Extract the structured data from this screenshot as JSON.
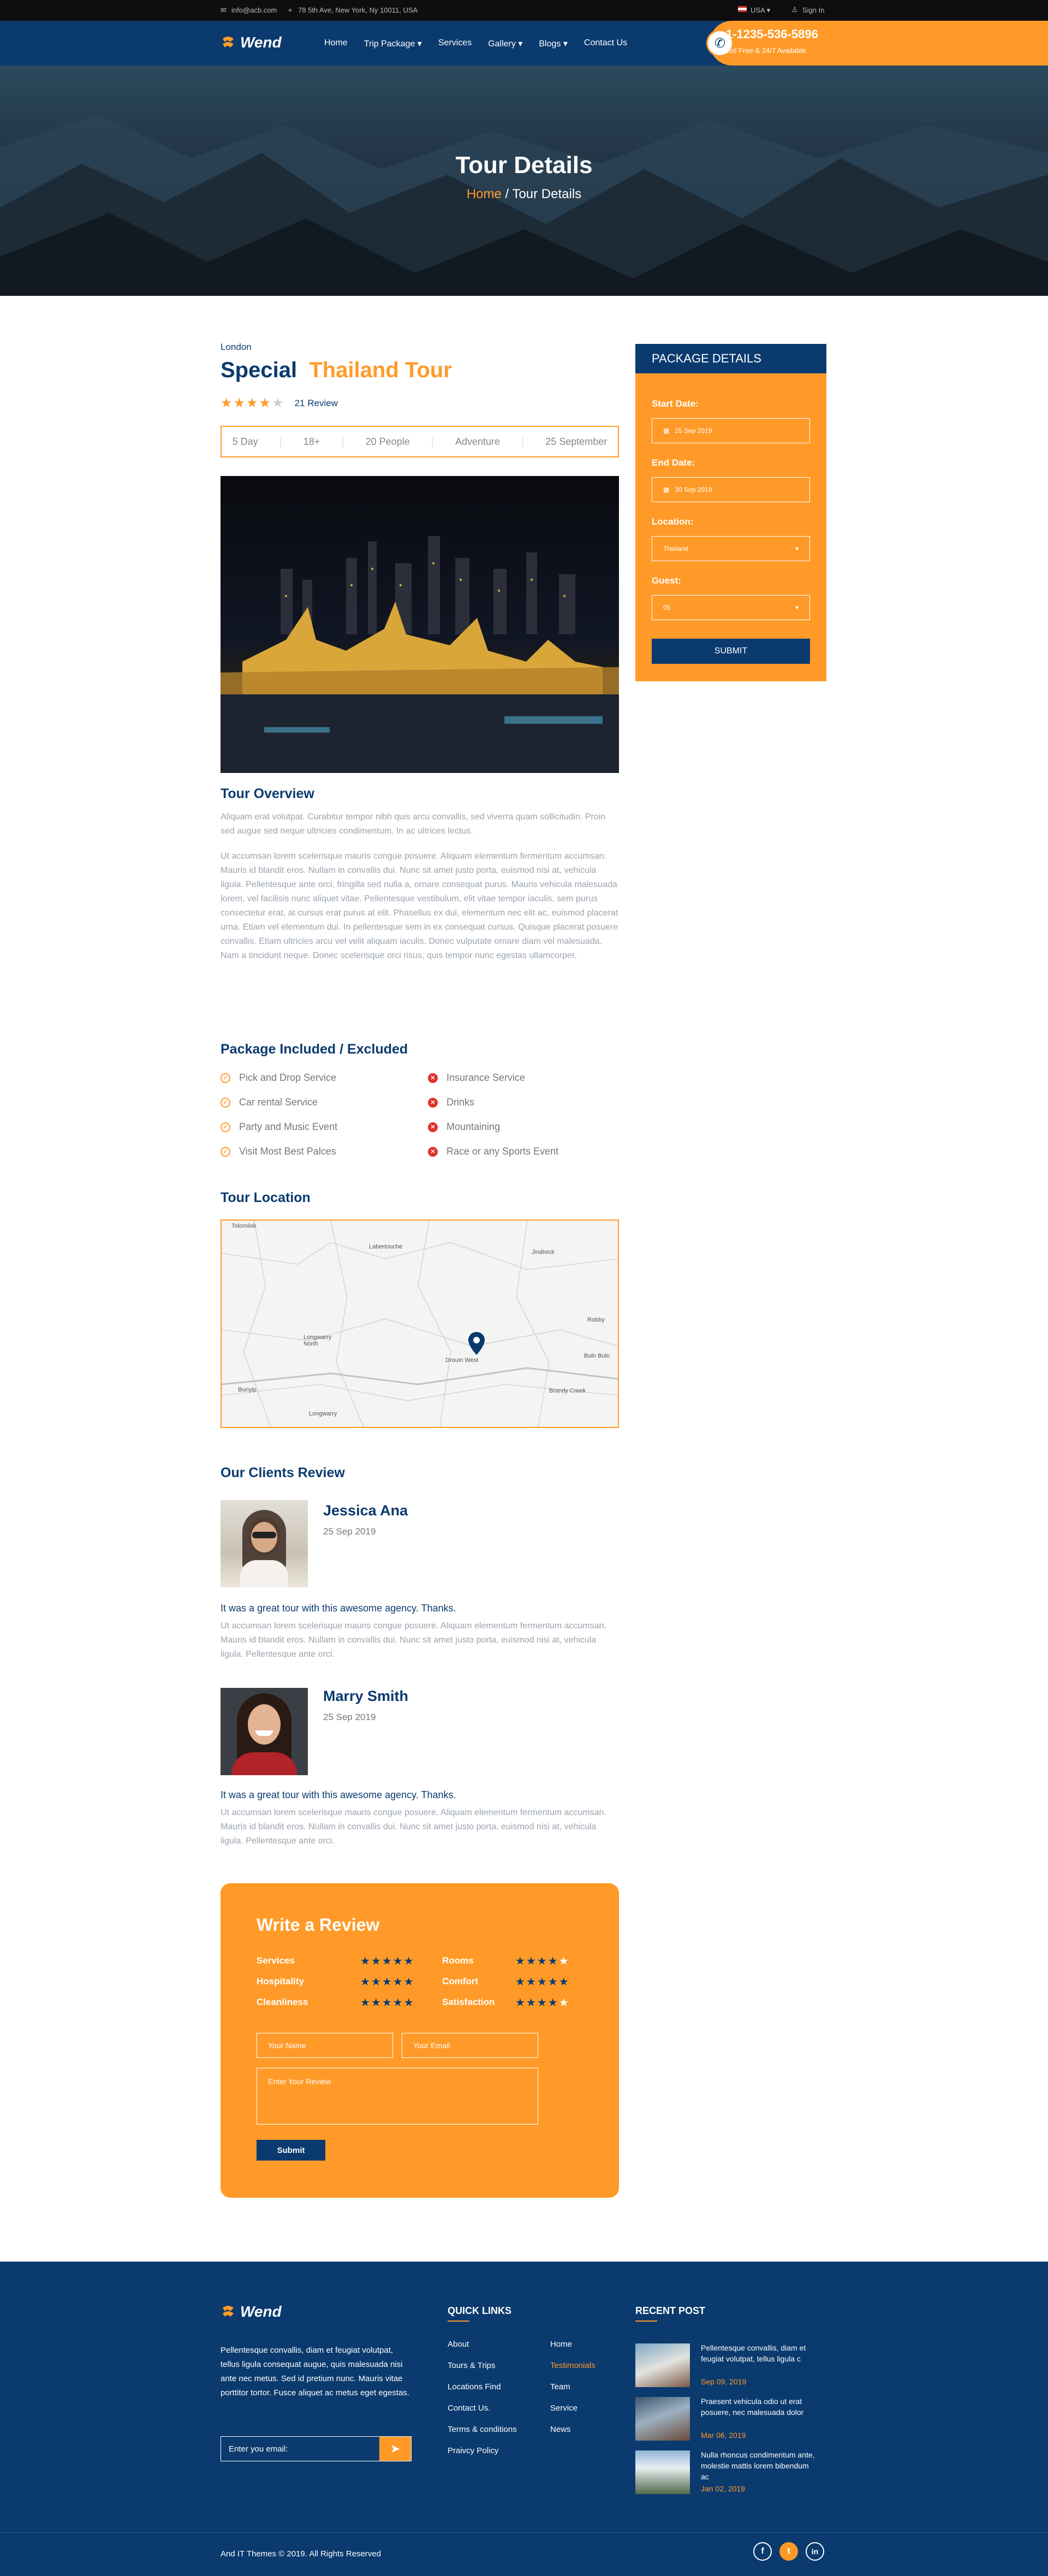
{
  "topbar": {
    "email": "info@acb.com",
    "address": "78 5th Ave, New York, Ny 10011, USA",
    "language": "USA",
    "signin": "Sign In"
  },
  "header": {
    "logo": "Wend",
    "nav": [
      "Home",
      "Trip Package",
      "Services",
      "Gallery",
      "Blogs",
      "Contact Us"
    ],
    "phone": "1-1235-536-5896",
    "phone_note": "Toll Free & 24/7 Available"
  },
  "hero": {
    "title": "Tour Details",
    "breadcrumb_home": "Home",
    "breadcrumb_sep": " / ",
    "breadcrumb_current": "Tour Details"
  },
  "tour": {
    "city": "London",
    "title_a": "Special",
    "title_b": "Thailand Tour",
    "rating": 4,
    "rating_max": 5,
    "reviews": "21 Review",
    "info": [
      "5 Day",
      "18+",
      "20 People",
      "Adventure",
      "25 September"
    ]
  },
  "overview": {
    "heading": "Tour Overview",
    "p1": "Aliquam erat volutpat. Curabitur tempor nibh quis arcu convallis, sed viverra quam sollicitudin. Proin sed augue sed neque ultricies condimentum. In ac ultrices lectus.",
    "p2": "Ut accumsan lorem scelerisque mauris congue posuere. Aliquam elementum fermentum accumsan. Mauris id blandit eros. Nullam in convallis dui. Nunc sit amet justo porta, euismod nisi at, vehicula ligula. Pellentesque ante orci, fringilla sed nulla a, ornare consequat purus. Mauris vehicula malesuada lorem, vel facilisis nunc aliquet vitae. Pellentesque vestibulum, elit vitae tempor iaculis, sem purus consectetur erat, at cursus erat purus at elit. Phasellus ex dui, elementum nec elit ac, euismod placerat urna. Etiam vel elementum dui. In pellentesque sem in ex consequat cursus. Quisque placerat posuere convallis. Etiam ultricies arcu vel velit aliquam iaculis. Donec vulputate ornare diam vel malesuada. Nam a tincidunt neque. Donec scelerisque orci risus, quis tempor nunc egestas ullamcorper."
  },
  "package": {
    "heading": "Package Included / Excluded",
    "included": [
      "Pick and Drop Service",
      "Car rental Service",
      "Party and Music Event",
      "Visit Most Best Palces"
    ],
    "excluded": [
      "Insurance Service",
      "Drinks",
      "Mountaining",
      "Race or any Sports Event"
    ]
  },
  "location": {
    "heading": "Tour Location",
    "map_labels": [
      "Tolomlisk",
      "Labertouche",
      "Jindivick",
      "Robby",
      "Buln Buln",
      "Longwarry North",
      "Drouin West",
      "Bunyip",
      "Longwarry",
      "Brandy Creek"
    ]
  },
  "reviews": {
    "heading": "Our Clients Review",
    "items": [
      {
        "name": "Jessica Ana",
        "date": "25 Sep 2019",
        "quote": "It was a great tour with this awesome agency. Thanks.",
        "text": "Ut accumsan lorem scelerisque mauris congue posuere. Aliquam elementum fermentum accumsan. Mauris id blandit eros. Nullam in convallis dui. Nunc sit amet justo porta, euismod nisi at, vehicula ligula. Pellentesque ante orci."
      },
      {
        "name": "Marry Smith",
        "date": "25 Sep 2019",
        "quote": "It was a great tour with this awesome agency. Thanks.",
        "text": "Ut accumsan lorem scelerisque mauris congue posuere. Aliquam elementum fermentum accumsan. Mauris id blandit eros. Nullam in convallis dui. Nunc sit amet justo porta, euismod nisi at, vehicula ligula. Pellentesque ante orci."
      }
    ]
  },
  "write_review": {
    "heading": "Write a Review",
    "ratings": [
      {
        "label": "Services",
        "stars": 5
      },
      {
        "label": "Rooms",
        "stars": 4
      },
      {
        "label": "Hospitality",
        "stars": 5
      },
      {
        "label": "Comfort",
        "stars": 5
      },
      {
        "label": "Cleanliness",
        "stars": 5
      },
      {
        "label": "Satisfaction",
        "stars": 4
      }
    ],
    "name_placeholder": "Your Name",
    "email_placeholder": "Your Email",
    "review_placeholder": "Enter Your Review",
    "submit": "Submit"
  },
  "sidebar": {
    "heading": "PACKAGE DETAILS",
    "start_label": "Start Date:",
    "start_value": "25 Sep 2019",
    "end_label": "End Date:",
    "end_value": "30 Sep 2019",
    "location_label": "Location:",
    "location_value": "Thailand",
    "guest_label": "Guest:",
    "guest_value": "05",
    "submit": "SUBMIT"
  },
  "footer": {
    "logo": "Wend",
    "about": "Pellentesque convallis, diam et feugiat volutpat, tellus ligula consequat augue, quis malesuada nisi ante nec metus. Sed id pretium nunc. Mauris vitae porttitor tortor. Fusce aliquet ac metus eget egestas.",
    "email_placeholder": "Enter you email:",
    "quick_links_heading": "QUICK LINKS",
    "links_col1": [
      "About",
      "Tours & Trips",
      "Locations Find",
      "Contact Us.",
      "Terms & conditions",
      "Praivcy Policy"
    ],
    "links_col2": [
      "Home",
      "Testimonials",
      "Team",
      "Service",
      "News"
    ],
    "recent_heading": "RECENT POST",
    "posts": [
      {
        "title": "Pellentesque convallis, diam et feugiat volutpat, tellus ligula c",
        "date": "Sep 09, 2019"
      },
      {
        "title": "Praesent vehicula odio ut erat posuere, nec malesuada dolor",
        "date": "Mar 06, 2019"
      },
      {
        "title": "Nulla rhoncus condimentum ante, molestie mattis lorem bibendum ac",
        "date": "Jan 02, 2019"
      }
    ],
    "copyright": "And IT Themes © 2019. All Rights Reserved"
  },
  "colors": {
    "primary": "#0a3a6e",
    "accent": "#ff9a28",
    "danger": "#e0312b"
  }
}
